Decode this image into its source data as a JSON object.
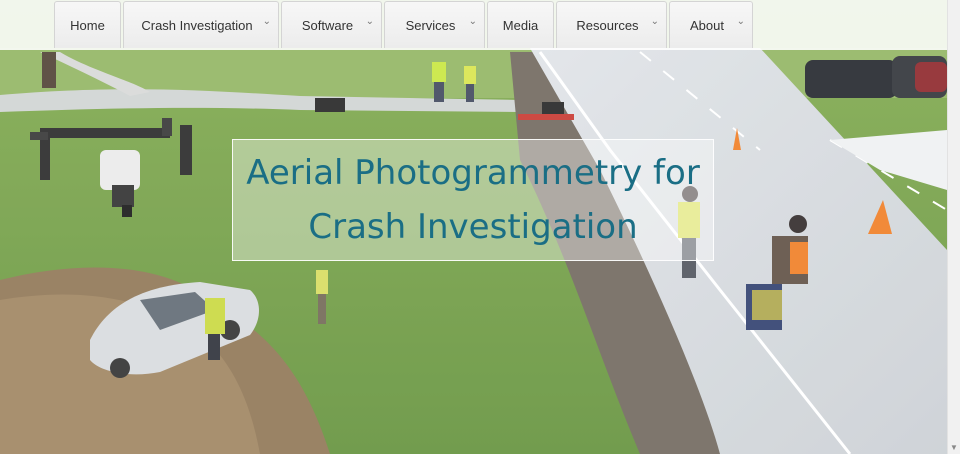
{
  "nav": {
    "items": [
      {
        "label": "Home",
        "has_menu": false
      },
      {
        "label": "Crash Investigation",
        "has_menu": true
      },
      {
        "label": "Software",
        "has_menu": true
      },
      {
        "label": "Services",
        "has_menu": true
      },
      {
        "label": "Media",
        "has_menu": false
      },
      {
        "label": "Resources",
        "has_menu": true
      },
      {
        "label": "About",
        "has_menu": true
      }
    ],
    "chevron_icon": "chevron-down-icon"
  },
  "hero": {
    "title_line1": "Aerial Photogrammetry for",
    "title_line2": "Crash Investigation",
    "title_color": "#1a6e85"
  }
}
